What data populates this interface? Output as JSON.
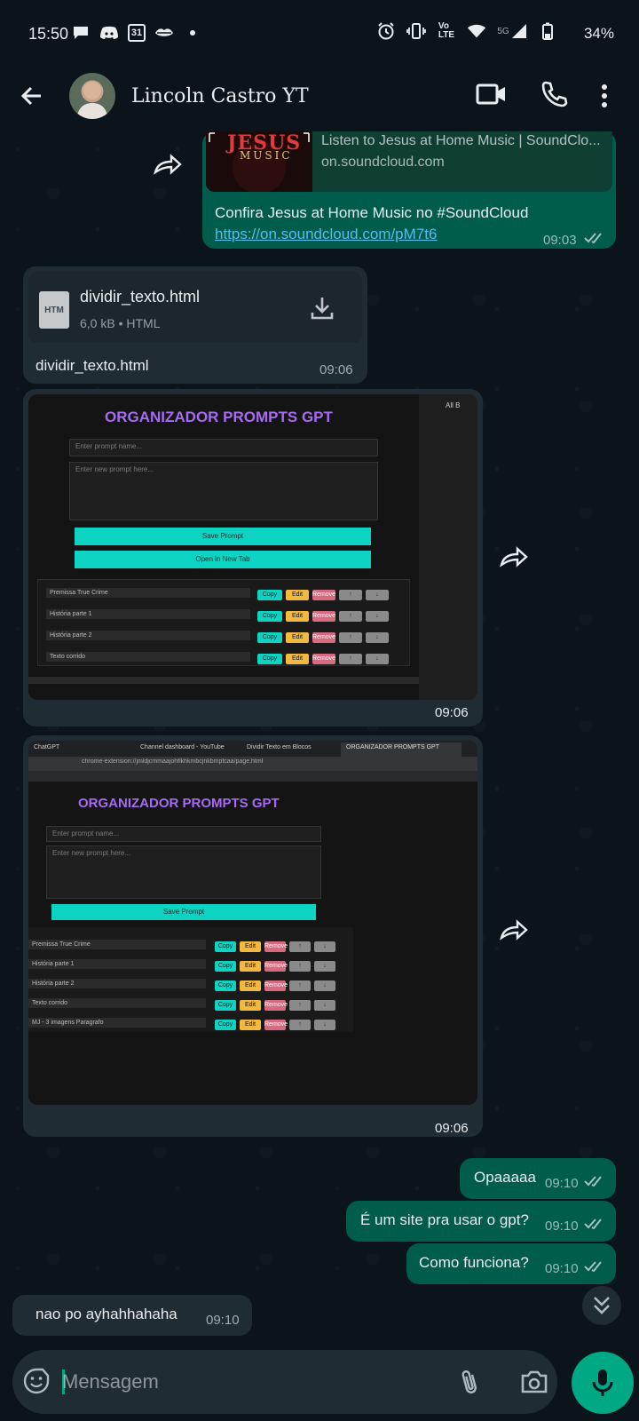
{
  "status_bar": {
    "time": "15:50",
    "calendar_day": "31",
    "network": "5G",
    "battery": "34%"
  },
  "header": {
    "contact_name": "Lincoln Castro YT"
  },
  "messages": {
    "link": {
      "thumb_big": "JESUS",
      "thumb_small": "MUSIC",
      "preview_title": "Listen to Jesus at Home Music | SoundClo...",
      "preview_domain": "on.soundcloud.com",
      "text": "Confira Jesus at Home Music no #SoundCloud",
      "url": "https://on.soundcloud.com/pM7t6",
      "time": "09:03"
    },
    "file": {
      "icon_label": "HTM",
      "name": "dividir_texto.html",
      "meta": "6,0 kB • HTML",
      "caption": "dividir_texto.html",
      "time": "09:06"
    },
    "image1": {
      "time": "09:06",
      "title": "ORGANIZADOR PROMPTS GPT",
      "name_placeholder": "Enter prompt name...",
      "prompt_placeholder": "Enter new prompt here...",
      "save_label": "Save Prompt",
      "open_tab_label": "Open in New Tab",
      "rows": [
        "Premissa True Crime",
        "História parte 1",
        "História parte 2",
        "Texto corrido"
      ],
      "btn_copy": "Copy",
      "btn_edit": "Edit",
      "btn_remove": "Remove",
      "btn_up": "↑",
      "btn_down": "↓",
      "bookmark_label": "All B"
    },
    "image2": {
      "time": "09:06",
      "title": "ORGANIZADOR PROMPTS GPT",
      "tabs": [
        "ChatGPT",
        "Channel dashboard - YouTube",
        "Dividir Texto em Blocos",
        "ORGANIZADOR PROMPTS GPT"
      ],
      "address": "chrome-extension://jmldjcmmaajohflkhkmbcjnkbmpfcaa/page.html",
      "name_placeholder": "Enter prompt name...",
      "prompt_placeholder": "Enter new prompt here...",
      "save_label": "Save Prompt",
      "rows": [
        "Premissa True Crime",
        "História parte 1",
        "História parte 2",
        "Texto corrido",
        "MJ - 3 imagens Paragrafo"
      ],
      "btn_copy": "Copy",
      "btn_edit": "Edit",
      "btn_remove": "Remove",
      "btn_up": "↑",
      "btn_down": "↓"
    },
    "out1": {
      "text": "Opaaaaa",
      "time": "09:10"
    },
    "out2": {
      "text": "É um site pra usar o gpt?",
      "time": "09:10"
    },
    "out3": {
      "text": "Como funciona?",
      "time": "09:10"
    },
    "in1": {
      "text": "nao po ayhahhahaha",
      "time": "09:10"
    }
  },
  "compose": {
    "placeholder": "Mensagem"
  },
  "colors": {
    "accent": "#00a884",
    "outgoing_bubble": "#005c4b",
    "incoming_bubble": "#202c33",
    "link": "#53bdeb",
    "mock_title": "#a66bf0",
    "mock_button": "#0dd3c3"
  },
  "icons": {
    "back": "arrow-left-icon",
    "video": "video-camera-icon",
    "call": "phone-icon",
    "menu": "more-vert-icon",
    "forward": "forward-icon",
    "download": "download-icon",
    "emoji": "emoji-icon",
    "attach": "paperclip-icon",
    "camera": "camera-icon",
    "mic": "microphone-icon",
    "scroll": "double-chevron-down-icon"
  }
}
